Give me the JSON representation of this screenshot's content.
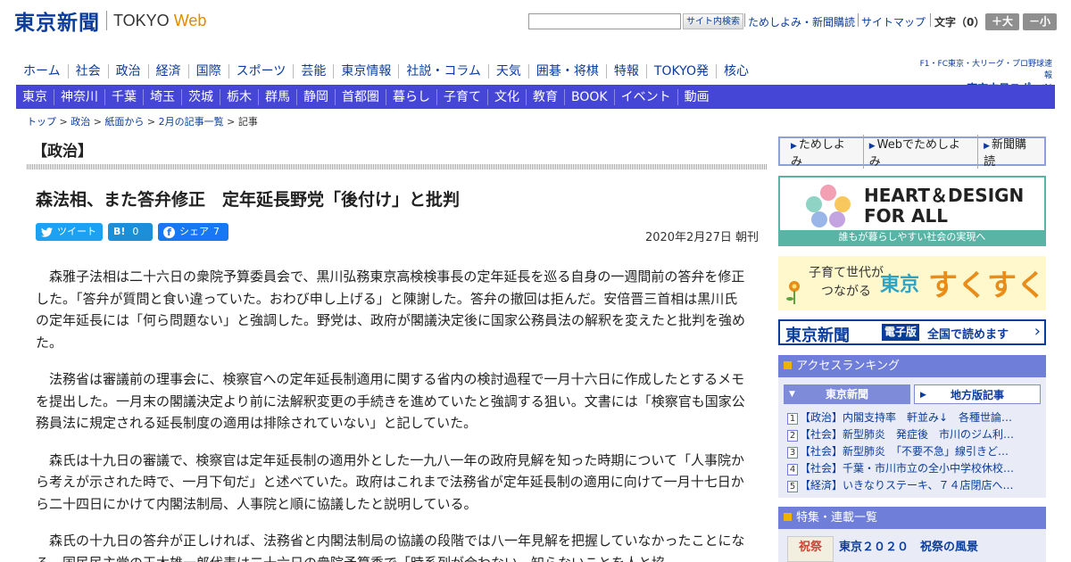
{
  "header": {
    "logo_jp": "東京新聞",
    "logo_en_a": "TOKYO",
    "logo_en_b": "Web",
    "search_button": "サイト内検索",
    "links": [
      "ためしよみ・新聞購読",
      "サイトマップ"
    ],
    "font_size_label": "文字（0）",
    "font_plus": "＋大",
    "font_minus": "－小"
  },
  "nav_main": [
    "ホーム",
    "社会",
    "政治",
    "経済",
    "国際",
    "スポーツ",
    "芸能",
    "東京情報",
    "社説・コラム",
    "天気",
    "囲碁・将棋",
    "特報",
    "TOKYO発",
    "核心"
  ],
  "chunichi": {
    "line1": "F1・FC東京・大リーグ・プロ野球速報",
    "line2": "東京中日スポーツ"
  },
  "nav_local": [
    "東京",
    "神奈川",
    "千葉",
    "埼玉",
    "茨城",
    "栃木",
    "群馬",
    "静岡",
    "首都圏",
    "暮らし",
    "子育て",
    "文化",
    "教育",
    "BOOK",
    "イベント",
    "動画"
  ],
  "breadcrumb": [
    "トップ",
    "政治",
    "紙面から",
    "2月の記事一覧",
    "記事"
  ],
  "article": {
    "section": "【政治】",
    "headline": "森法相、また答弁修正　定年延長野党「後付け」と批判",
    "share": {
      "tweet": "ツイート",
      "hatena": "B!",
      "hatena_count": "0",
      "fb": "シェア",
      "fb_count": "7"
    },
    "date": "2020年2月27日 朝刊",
    "paragraphs": [
      "森雅子法相は二十六日の衆院予算委員会で、黒川弘務東京高検検事長の定年延長を巡る自身の一週間前の答弁を修正した。「答弁が質問と食い違っていた。おわび申し上げる」と陳謝した。答弁の撤回は拒んだ。安倍晋三首相は黒川氏の定年延長には「何ら問題ない」と強調した。野党は、政府が閣議決定後に国家公務員法の解釈を変えたと批判を強めた。",
      "法務省は審議前の理事会に、検察官への定年延長制適用に関する省内の検討過程で一月十六日に作成したとするメモを提出した。一月末の閣議決定より前に法解釈変更の手続きを進めていたと強調する狙い。文書には「検察官も国家公務員法に規定される延長制度の適用は排除されていない」と記していた。",
      "森氏は十九日の審議で、検察官は定年延長制の適用外とした一九八一年の政府見解を知った時期について「人事院から考えが示された時で、一月下旬だ」と述べていた。政府はこれまで法務省が定年延長制の適用に向けて一月十七日から二十四日にかけて内閣法制局、人事院と順に協議したと説明している。",
      "森氏の十九日の答弁が正しければ、法務省と内閣法制局の協議の段階では八一年見解を把握していなかったことになる。国民民主党の玉木雄一郎代表は二十六日の衆院予算委で「時系列が合わない。知らないことを人と協"
    ]
  },
  "sidebar": {
    "trial_links": [
      "ためしよみ",
      "Webでためしよみ",
      "新聞購読"
    ],
    "heart_title_1": "HEART＆DESIGN",
    "heart_title_2": "FOR ALL",
    "heart_foot": "誰もが暮らしやすい社会の実現へ",
    "suku_l1": "子育て世代が",
    "suku_l2": "つながる",
    "suku_tokyo": "東京",
    "suku_main": "すくすく",
    "edition_logo": "東京新聞",
    "edition_tag": "電子版",
    "edition_text": "全国で読めます",
    "ranking_title": "アクセスランキング",
    "ranking_tabs": [
      "東京新聞",
      "地方版記事"
    ],
    "ranking": [
      "【政治】内閣支持率　軒並み↓　各種世論…",
      "【社会】新型肺炎　発症後　市川のジム利…",
      "【社会】新型肺炎　「不要不急」線引きど…",
      "【社会】千葉・市川市立の全小中学校休校…",
      "【経済】いきなりステーキ、７４店閉店へ…"
    ],
    "feature_title": "特集・連載一覧",
    "feature_thumb": "祝祭",
    "feature_item": "東京２０２０　祝祭の風景"
  }
}
